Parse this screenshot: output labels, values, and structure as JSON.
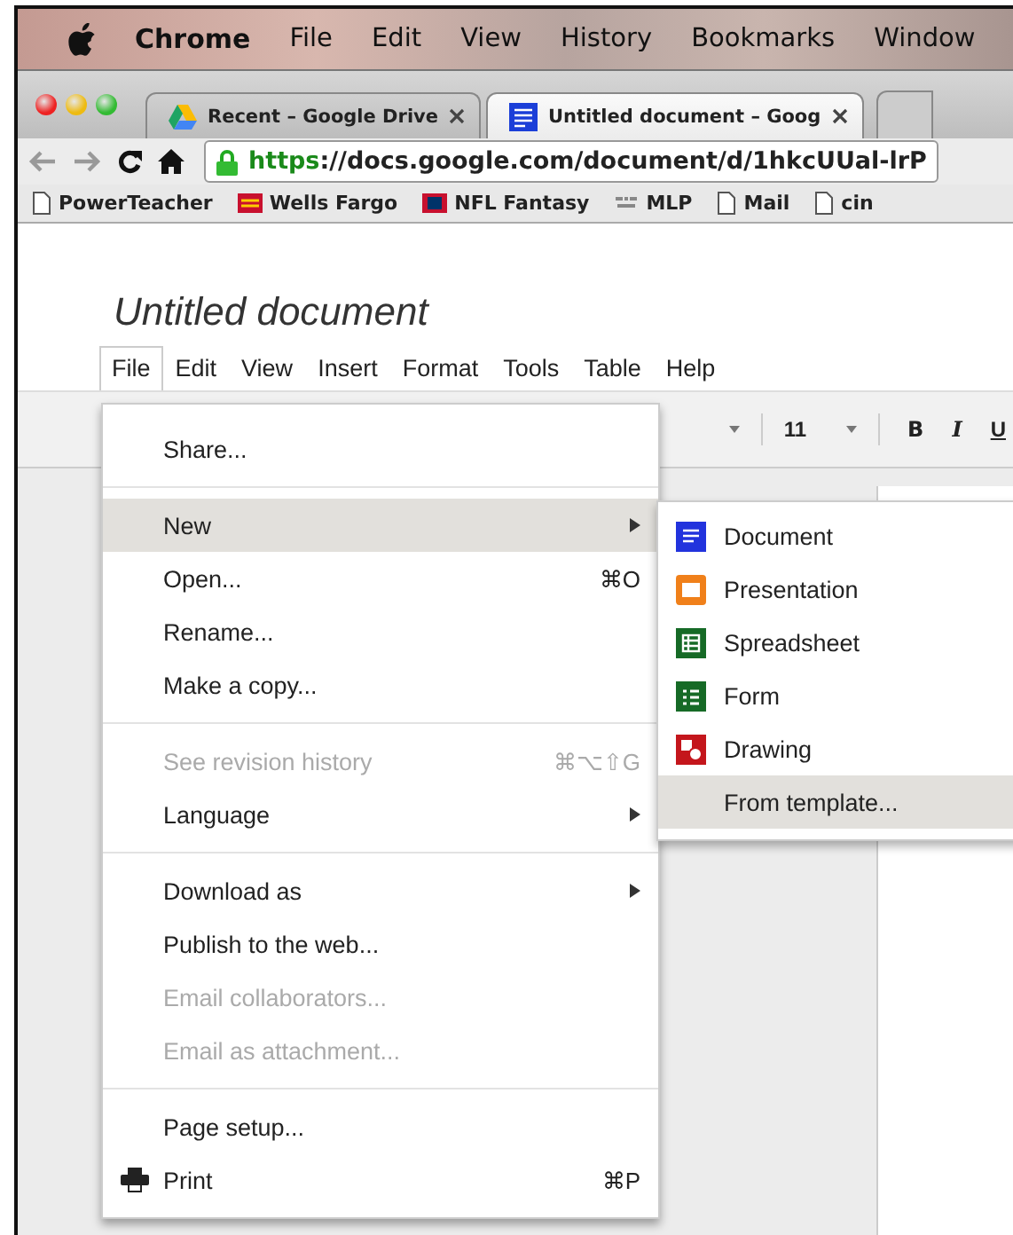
{
  "mac_menu_bar": {
    "items": [
      "Chrome",
      "File",
      "Edit",
      "View",
      "History",
      "Bookmarks",
      "Window"
    ]
  },
  "tabs": [
    {
      "label": "Recent – Google Drive",
      "kind": "drive",
      "selected": false
    },
    {
      "label": "Untitled document – Goog",
      "kind": "docs",
      "selected": true
    }
  ],
  "address_bar": {
    "url_scheme": "https",
    "url_rest": "://docs.google.com/document/d/1hkcUUal-lrP"
  },
  "bookmarks": [
    {
      "label": "PowerTeacher",
      "kind": "page"
    },
    {
      "label": "Wells Fargo",
      "kind": "wf"
    },
    {
      "label": "NFL Fantasy",
      "kind": "nfl"
    },
    {
      "label": "MLP",
      "kind": "mlp"
    },
    {
      "label": "Mail",
      "kind": "page"
    },
    {
      "label": "cin",
      "kind": "page"
    }
  ],
  "document": {
    "title": "Untitled document"
  },
  "docs_menu": [
    {
      "label": "File",
      "selected": true
    },
    {
      "label": "Edit",
      "selected": false
    },
    {
      "label": "View",
      "selected": false
    },
    {
      "label": "Insert",
      "selected": false
    },
    {
      "label": "Format",
      "selected": false
    },
    {
      "label": "Tools",
      "selected": false
    },
    {
      "label": "Table",
      "selected": false
    },
    {
      "label": "Help",
      "selected": false
    }
  ],
  "toolbar": {
    "font_size": "11",
    "bold": "B",
    "italic": "I",
    "underline": "U"
  },
  "file_menu": {
    "groups": [
      [
        {
          "label": "Share...",
          "kind": "plain",
          "selected": false,
          "disabled": false,
          "submenu": false
        }
      ],
      [
        {
          "label": "New",
          "kind": "plain",
          "selected": true,
          "disabled": false,
          "submenu": true
        },
        {
          "label": "Open...",
          "shortcut": "⌘O",
          "kind": "plain",
          "selected": false,
          "disabled": false,
          "submenu": false
        },
        {
          "label": "Rename...",
          "kind": "plain",
          "selected": false,
          "disabled": false,
          "submenu": false
        },
        {
          "label": "Make a copy...",
          "kind": "plain",
          "selected": false,
          "disabled": false,
          "submenu": false
        }
      ],
      [
        {
          "label": "See revision history",
          "shortcut": "⌘⌥⇧G",
          "kind": "plain",
          "selected": false,
          "disabled": true,
          "submenu": false
        },
        {
          "label": "Language",
          "kind": "plain",
          "selected": false,
          "disabled": false,
          "submenu": true
        }
      ],
      [
        {
          "label": "Download as",
          "kind": "plain",
          "selected": false,
          "disabled": false,
          "submenu": true
        },
        {
          "label": "Publish to the web...",
          "kind": "plain",
          "selected": false,
          "disabled": false,
          "submenu": false
        },
        {
          "label": "Email collaborators...",
          "kind": "plain",
          "selected": false,
          "disabled": true,
          "submenu": false
        },
        {
          "label": "Email as attachment...",
          "kind": "plain",
          "selected": false,
          "disabled": true,
          "submenu": false
        }
      ],
      [
        {
          "label": "Page setup...",
          "kind": "plain",
          "selected": false,
          "disabled": false,
          "submenu": false
        },
        {
          "label": "Print",
          "shortcut": "⌘P",
          "kind": "printer",
          "selected": false,
          "disabled": false,
          "submenu": false
        }
      ]
    ]
  },
  "new_submenu": [
    {
      "label": "Document",
      "kind": "document",
      "selected": false
    },
    {
      "label": "Presentation",
      "kind": "presentation",
      "selected": false
    },
    {
      "label": "Spreadsheet",
      "kind": "spreadsheet",
      "selected": false
    },
    {
      "label": "Form",
      "kind": "form",
      "selected": false
    },
    {
      "label": "Drawing",
      "kind": "drawing",
      "selected": false
    },
    {
      "label": "From template...",
      "kind": "template",
      "selected": true
    }
  ]
}
